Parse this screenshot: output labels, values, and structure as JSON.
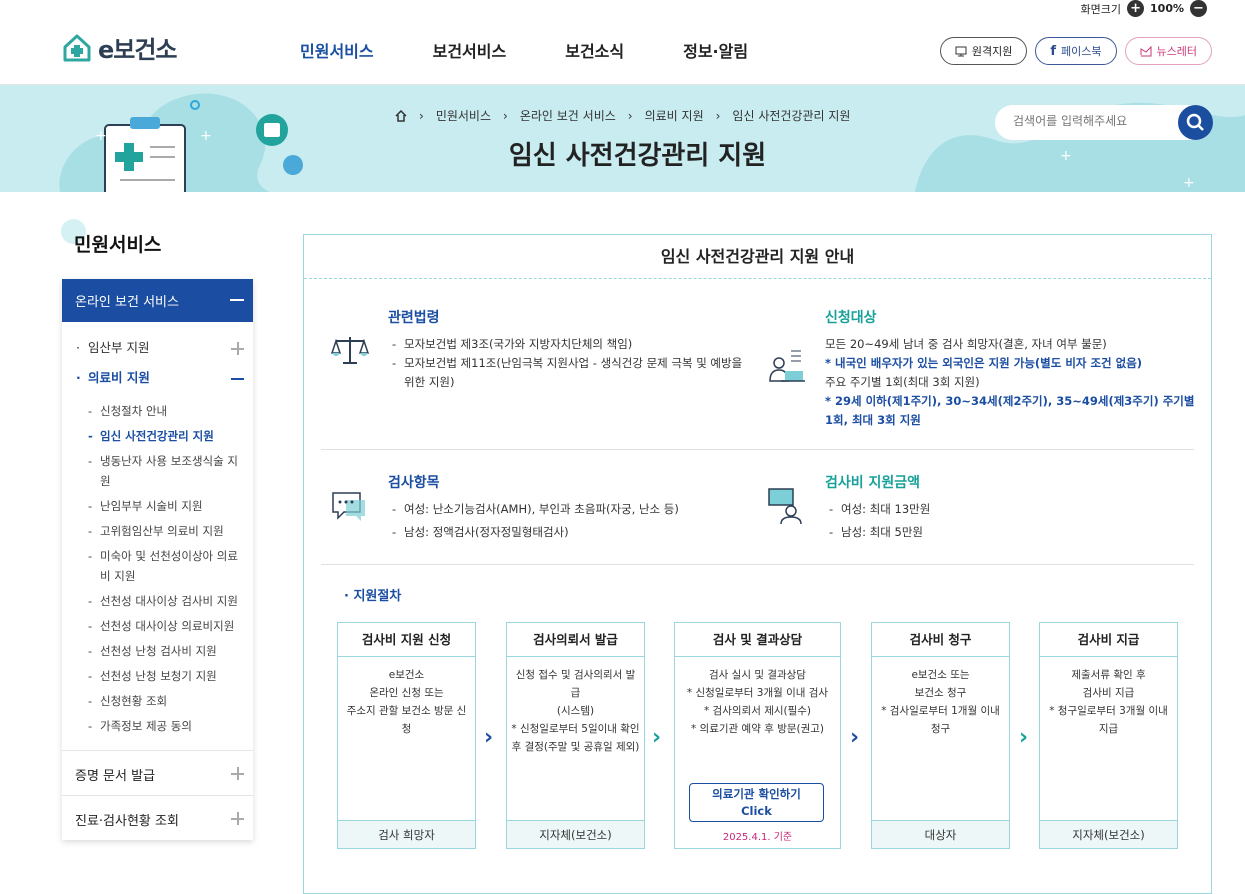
{
  "topbar": {
    "zoom_label": "화면크기",
    "zoom_value": "100%"
  },
  "logo": {
    "text": "e보건소"
  },
  "gnb": [
    "민원서비스",
    "보건서비스",
    "보건소식",
    "정보·알림"
  ],
  "header_buttons": {
    "remote": "원격지원",
    "facebook": "페이스북",
    "newsletter": "뉴스레터"
  },
  "breadcrumb": [
    "민원서비스",
    "온라인 보건 서비스",
    "의료비 지원",
    "임신 사전건강관리 지원"
  ],
  "page_title": "임신 사전건강관리 지원",
  "search": {
    "placeholder": "검색어를 입력해주세요"
  },
  "lnb": {
    "title": "민원서비스",
    "section": "온라인 보건 서비스",
    "items": [
      {
        "label": "임산부 지원"
      },
      {
        "label": "의료비 지원"
      }
    ],
    "subitems": [
      "신청절차 안내",
      "임신 사전건강관리 지원",
      "냉동난자 사용 보조생식술 지원",
      "난임부부 시술비 지원",
      "고위험임산부 의료비 지원",
      "미숙아 및 선천성이상아 의료비 지원",
      "선천성 대사이상 검사비 지원",
      "선천성 대사이상 의료비지원",
      "선천성 난청 검사비 지원",
      "선천성 난청 보청기 지원",
      "신청현황 조회",
      "가족정보 제공 동의"
    ],
    "bottom": [
      "증명 문서 발급",
      "진료·검사현황 조회"
    ]
  },
  "content": {
    "title": "임신 사전건강관리 지원 안내",
    "law": {
      "heading": "관련법령",
      "items": [
        "모자보건법 제3조(국가와 지방자치단체의 책임)",
        "모자보건법 제11조(난임극복 지원사업 - 생식건강 문제 극복 및 예방을 위한 지원)"
      ]
    },
    "target": {
      "heading": "신청대상",
      "line1": "모든 20~49세 남녀 중 검사 희망자(결혼, 자녀 여부 불문)",
      "note1": "* 내국인 배우자가 있는 외국인은 지원 가능(별도 비자 조건 없음)",
      "line2": "주요 주기별 1회(최대 3회 지원)",
      "note2": "* 29세 이하(제1주기), 30~34세(제2주기), 35~49세(제3주기) 주기별 1회, 최대 3회 지원"
    },
    "tests": {
      "heading": "검사항목",
      "items": [
        "여성: 난소기능검사(AMH), 부인과 초음파(자궁, 난소 등)",
        "남성: 정액검사(정자정밀형태검사)"
      ]
    },
    "amount": {
      "heading": "검사비 지원금액",
      "items": [
        "여성: 최대 13만원",
        "남성: 최대 5만원"
      ]
    },
    "procedure_title": "· 지원절차",
    "steps": [
      {
        "title": "검사비 지원 신청",
        "body": [
          "e보건소",
          "온라인 신청 또는",
          "주소지 관할 보건소 방문 신청"
        ],
        "footer": "검사 희망자"
      },
      {
        "title": "검사의뢰서 발급",
        "body": [
          "신청 접수 및 검사의뢰서 발급",
          "(시스템)",
          "* 신청일로부터 5일이내 확인",
          "후 결정(주말 및 공휴일 제외)"
        ],
        "footer": "지자체(보건소)"
      },
      {
        "title": "검사 및 결과상담",
        "body": [
          "검사 실시 및 결과상담",
          "* 신청일로부터 3개월 이내 검사",
          "* 검사의뢰서 제시(필수)",
          "* 의료기관 예약 후 방문(권고)"
        ],
        "button": [
          "의료기관 확인하기",
          "Click"
        ],
        "date": "2025.4.1. 기준"
      },
      {
        "title": "검사비 청구",
        "body": [
          "e보건소 또는",
          "보건소 청구",
          "* 검사일로부터 1개월 이내",
          "청구"
        ],
        "footer": "대상자"
      },
      {
        "title": "검사비 지급",
        "body": [
          "제출서류 확인 후",
          "검사비 지급",
          "* 청구일로부터 3개월 이내",
          "지급"
        ],
        "footer": "지자체(보건소)"
      }
    ]
  },
  "colors": {
    "primary": "#1b4ea2",
    "teal": "#17a19a",
    "banner": "#c8ecf0",
    "border": "#9ad6dc"
  }
}
